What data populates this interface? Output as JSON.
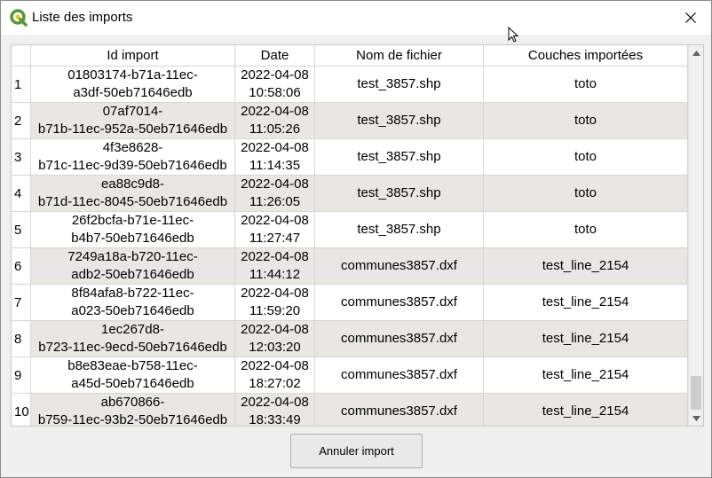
{
  "window": {
    "title": "Liste des imports"
  },
  "colors": {
    "alt_row": "#e9e7e3",
    "qgis_green": "#589632",
    "qgis_yellow": "#eec90d"
  },
  "icons": {
    "app": "qgis-logo-icon",
    "close": "close-icon",
    "cursor": "mouse-pointer-icon",
    "scroll_up": "scroll-up-arrow-icon",
    "scroll_down": "scroll-down-arrow-icon"
  },
  "table": {
    "headers": [
      "Id import",
      "Date",
      "Nom de fichier",
      "Couches importées"
    ],
    "rows": [
      {
        "num": "1",
        "id1": "01803174-b71a-11ec-",
        "id2": "a3df-50eb71646edb",
        "date1": "2022-04-08",
        "date2": "10:58:06",
        "file": "test_3857.shp",
        "layer": "toto"
      },
      {
        "num": "2",
        "id1": "07af7014-",
        "id2": "b71b-11ec-952a-50eb71646edb",
        "date1": "2022-04-08",
        "date2": "11:05:26",
        "file": "test_3857.shp",
        "layer": "toto"
      },
      {
        "num": "3",
        "id1": "4f3e8628-",
        "id2": "b71c-11ec-9d39-50eb71646edb",
        "date1": "2022-04-08",
        "date2": "11:14:35",
        "file": "test_3857.shp",
        "layer": "toto"
      },
      {
        "num": "4",
        "id1": "ea88c9d8-",
        "id2": "b71d-11ec-8045-50eb71646edb",
        "date1": "2022-04-08",
        "date2": "11:26:05",
        "file": "test_3857.shp",
        "layer": "toto"
      },
      {
        "num": "5",
        "id1": "26f2bcfa-b71e-11ec-",
        "id2": "b4b7-50eb71646edb",
        "date1": "2022-04-08",
        "date2": "11:27:47",
        "file": "test_3857.shp",
        "layer": "toto"
      },
      {
        "num": "6",
        "id1": "7249a18a-b720-11ec-",
        "id2": "adb2-50eb71646edb",
        "date1": "2022-04-08",
        "date2": "11:44:12",
        "file": "communes3857.dxf",
        "layer": "test_line_2154"
      },
      {
        "num": "7",
        "id1": "8f84afa8-b722-11ec-",
        "id2": "a023-50eb71646edb",
        "date1": "2022-04-08",
        "date2": "11:59:20",
        "file": "communes3857.dxf",
        "layer": "test_line_2154"
      },
      {
        "num": "8",
        "id1": "1ec267d8-",
        "id2": "b723-11ec-9ecd-50eb71646edb",
        "date1": "2022-04-08",
        "date2": "12:03:20",
        "file": "communes3857.dxf",
        "layer": "test_line_2154"
      },
      {
        "num": "9",
        "id1": "b8e83eae-b758-11ec-",
        "id2": "a45d-50eb71646edb",
        "date1": "2022-04-08",
        "date2": "18:27:02",
        "file": "communes3857.dxf",
        "layer": "test_line_2154"
      },
      {
        "num": "10",
        "id1": "ab670866-",
        "id2": "b759-11ec-93b2-50eb71646edb",
        "date1": "2022-04-08",
        "date2": "18:33:49",
        "file": "communes3857.dxf",
        "layer": "test_line_2154"
      }
    ]
  },
  "buttons": {
    "cancel": "Annuler import"
  }
}
